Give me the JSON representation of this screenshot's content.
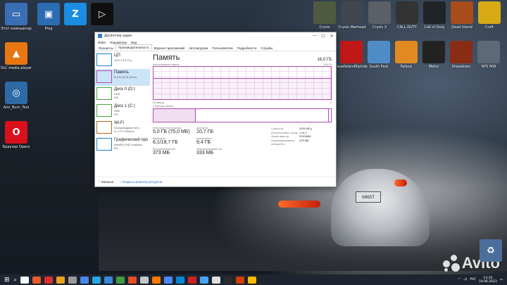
{
  "desktop_left": [
    {
      "label": "Этот компьютер",
      "bg": "#3a6fb5",
      "g": "▭"
    },
    {
      "label": "VLC media player",
      "bg": "#e87612",
      "g": "▲"
    },
    {
      "label": "Ami_Burn_Tool",
      "bg": "#2e6aa5",
      "g": "◎"
    },
    {
      "label": "Браузер Opera",
      "bg": "#d8111c",
      "g": "O"
    }
  ],
  "desktop_top": [
    {
      "label": "Prog",
      "bg": "#2b6cb3",
      "g": "▣"
    },
    {
      "label": "",
      "bg": "#1b8de0",
      "g": "Z"
    },
    {
      "label": "",
      "bg": "#101010",
      "g": "▷"
    }
  ],
  "desktop_right": [
    {
      "label": "Crysis",
      "bg": "#4d5a40",
      "g": ""
    },
    {
      "label": "Crysis Warhead",
      "bg": "#3f4650",
      "g": ""
    },
    {
      "label": "Crysis 3",
      "bg": "#5a6066",
      "g": ""
    },
    {
      "label": "CALL DUTY",
      "bg": "#333",
      "g": ""
    },
    {
      "label": "Call of Duty",
      "bg": "#202428",
      "g": ""
    },
    {
      "label": "Dead Island",
      "bg": "#a84c1b",
      "g": ""
    },
    {
      "label": "Craft",
      "bg": "#d6a915",
      "g": ""
    },
    {
      "label": "DeadIslandRiptide",
      "bg": "#c01818",
      "g": ""
    },
    {
      "label": "South Park",
      "bg": "#4f8cc6",
      "g": ""
    },
    {
      "label": "Fallout",
      "bg": "#e18a21",
      "g": ""
    },
    {
      "label": "Metro",
      "bg": "#222",
      "g": ""
    },
    {
      "label": "Showdown",
      "bg": "#8a2b13",
      "g": ""
    },
    {
      "label": "NFS MW",
      "bg": "#5c6a78",
      "g": ""
    }
  ],
  "window": {
    "title": "Диспетчер задач",
    "menu": [
      "Файл",
      "Параметры",
      "Вид"
    ],
    "tabs": [
      "Процессы",
      "Производительность",
      "Журнал приложений",
      "Автозагрузка",
      "Пользователи",
      "Подробности",
      "Службы"
    ],
    "active_tab": 1,
    "sidebar": [
      {
        "name": "ЦП",
        "sub1": "10% 3,19 ГГц",
        "sub2": "",
        "color": "#1a7fd0"
      },
      {
        "name": "Память",
        "sub1": "5,1/11,8 ГБ (32%)",
        "sub2": "",
        "color": "#b04ab0"
      },
      {
        "name": "Диск 0 (D:)",
        "sub1": "HDD",
        "sub2": "0%",
        "color": "#4aa33a"
      },
      {
        "name": "Диск 1 (C:)",
        "sub1": "SSD",
        "sub2": "0%",
        "color": "#4aa33a"
      },
      {
        "name": "Wi-Fi",
        "sub1": "Беспроводная сеть",
        "sub2": "О: 0 П: 0 Кбит/с",
        "color": "#a86a1f"
      },
      {
        "name": "Графический про",
        "sub1": "Intel(R) UHD Graphics",
        "sub2": "6%",
        "color": "#1a7fd0"
      }
    ],
    "main": {
      "title": "Память",
      "total": "16,0 ГБ",
      "usage_label": "Использование памяти",
      "usage_max": "15,8 ГБ",
      "seconds": "60 секунд",
      "zero": "0",
      "structure": "Структура памяти",
      "stats": [
        {
          "k": "Используется (сжатая)",
          "v": "5,0 ГБ (75,0 МБ)"
        },
        {
          "k": "Доступно",
          "v": "10,7 ГБ"
        },
        {
          "k": "Выделено",
          "v": "6,1/18,7 ГБ"
        },
        {
          "k": "Кэшировано",
          "v": "9,4 ГБ"
        },
        {
          "k": "Выгружаемый пул",
          "v": "373 МБ"
        },
        {
          "k": "Невыгружаемый пул",
          "v": "333 МБ"
        }
      ],
      "right": [
        {
          "k": "Скорость:",
          "v": "3200 МГц"
        },
        {
          "k": "Использовано гнезд:",
          "v": "1 из 2"
        },
        {
          "k": "Форм-фактор:",
          "v": "SODIMM"
        },
        {
          "k": "Зарезервировано аппаратно:",
          "v": "225 МБ"
        }
      ]
    },
    "footer": {
      "less": "Меньше",
      "monitor": "Открыть монитор ресурсов"
    }
  },
  "taskbar": {
    "icons": [
      "#ffffff",
      "#e85a2a",
      "#d92f2f",
      "#e9a11e",
      "#999",
      "#4a86e8",
      "#26a9e0",
      "#3a87d9",
      "#3e9c3e",
      "#e34f26",
      "#c7c7c7",
      "#ff7a00",
      "#4c8bf5",
      "#0a84d8",
      "#cc2222",
      "#4aa3ff",
      "#e0e0e0",
      "#2b2b2b",
      "#d83b01",
      "#ffb900"
    ],
    "lang": "РУС",
    "time": "13:10",
    "date": "18.06.2023"
  },
  "watermark": "Avito"
}
